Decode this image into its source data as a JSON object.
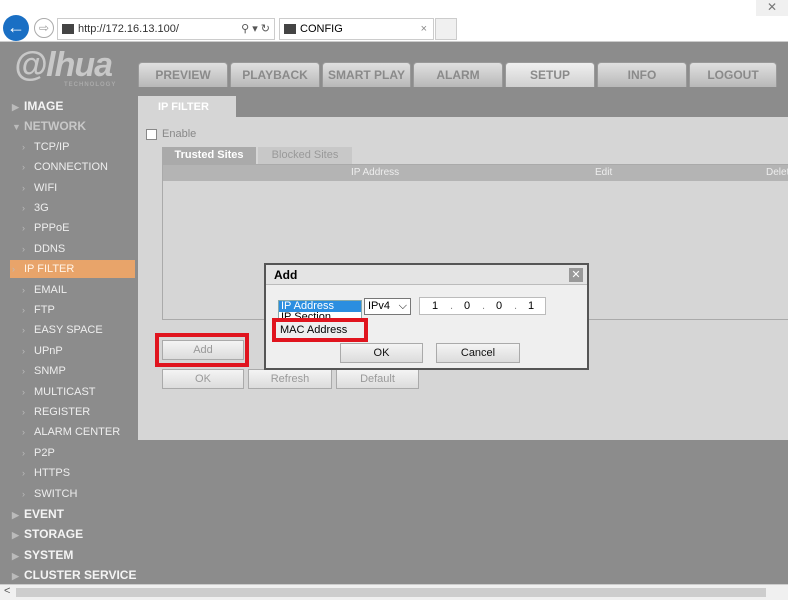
{
  "browser": {
    "url": "http://172.16.13.100/",
    "tab_title": "CONFIG"
  },
  "logo": {
    "text": "alhua",
    "sub": "TECHNOLOGY"
  },
  "nav": [
    "PREVIEW",
    "PLAYBACK",
    "SMART PLAY",
    "ALARM",
    "SETUP",
    "INFO",
    "LOGOUT"
  ],
  "nav_active": "SETUP",
  "sidebar": {
    "top": [
      "IMAGE",
      "NETWORK"
    ],
    "network_items": [
      "TCP/IP",
      "CONNECTION",
      "WIFI",
      "3G",
      "PPPoE",
      "DDNS",
      "IP FILTER",
      "EMAIL",
      "FTP",
      "EASY SPACE",
      "UPnP",
      "SNMP",
      "MULTICAST",
      "REGISTER",
      "ALARM CENTER",
      "P2P",
      "HTTPS",
      "SWITCH"
    ],
    "bottom": [
      "EVENT",
      "STORAGE",
      "SYSTEM",
      "CLUSTER SERVICE"
    ],
    "active": "IP FILTER"
  },
  "page": {
    "title": "IP FILTER",
    "enable_label": "Enable",
    "enabled": false,
    "subtabs": [
      "Trusted Sites",
      "Blocked Sites"
    ],
    "columns": [
      "IP Address",
      "Edit",
      "Delete"
    ],
    "add": "Add",
    "ok": "OK",
    "refresh": "Refresh",
    "default": "Default"
  },
  "dialog": {
    "title": "Add",
    "type_options": [
      "IP Address",
      "IP Section",
      "MAC Address"
    ],
    "selected_type": "IP Address",
    "ip_version": "IPv4",
    "ip": [
      "1",
      "0",
      "0",
      "1"
    ],
    "ok": "OK",
    "cancel": "Cancel"
  },
  "colors": {
    "highlight": "#e0141e",
    "active_sidebar": "#e8a46a"
  }
}
